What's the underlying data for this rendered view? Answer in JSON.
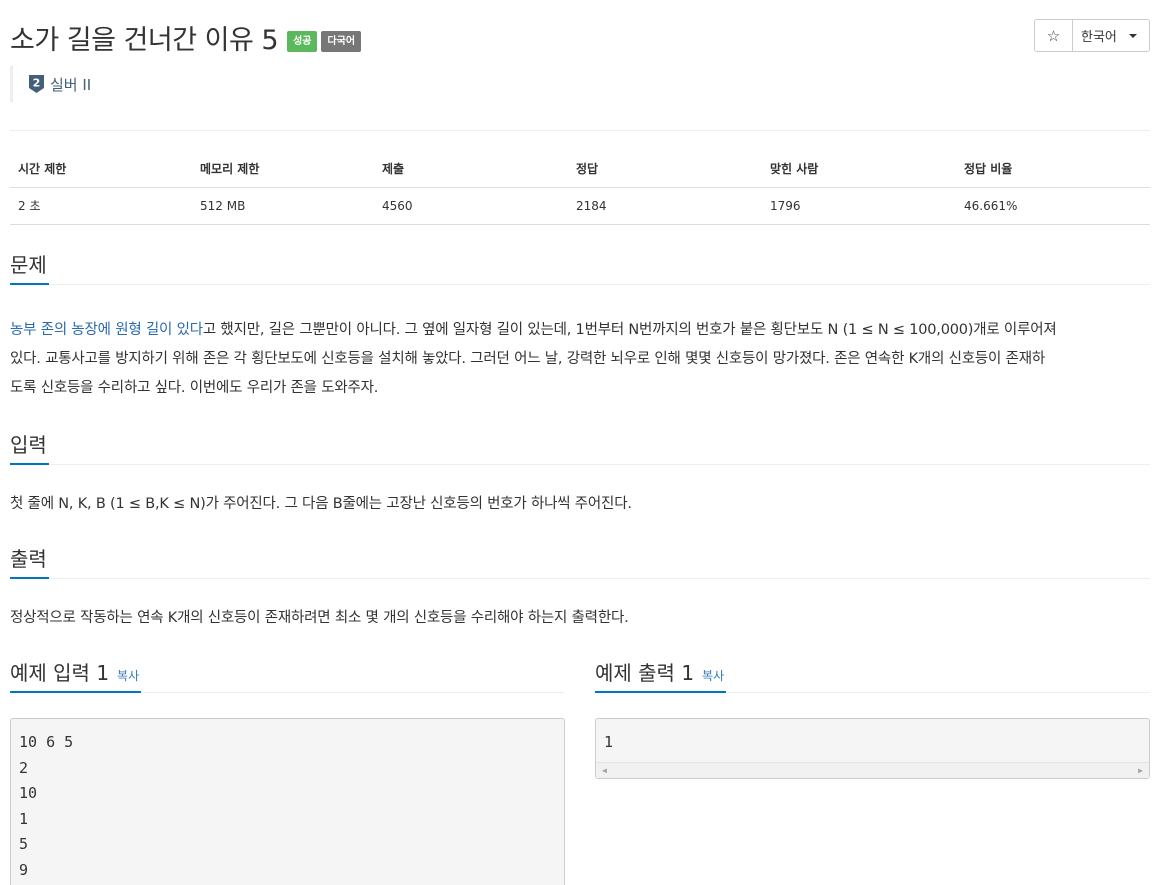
{
  "problem": {
    "title": "소가 길을 건너간 이유 5",
    "badges": [
      "성공",
      "다국어"
    ],
    "tier": "실버 II",
    "tier_number": "2"
  },
  "toolbar": {
    "star": "☆",
    "language": "한국어"
  },
  "info": {
    "headers": [
      "시간 제한",
      "메모리 제한",
      "제출",
      "정답",
      "맞힌 사람",
      "정답 비율"
    ],
    "values": [
      "2 초",
      "512 MB",
      "4560",
      "2184",
      "1796",
      "46.661%"
    ]
  },
  "sections": {
    "description_title": "문제",
    "description_link": "농부 존의 농장에 원형 길이 있다",
    "description_lines": [
      "고 했지만, 길은 그뿐만이 아니다. 그 옆에 일자형 길이 있는데, 1번부터 N번까지의 번호가 붙은 횡단보도 N (1 ≤ N ≤ 100,000)개로 이루어져",
      "있다. 교통사고를 방지하기 위해 존은 각 횡단보도에 신호등을 설치해 놓았다. 그러던 어느 날, 강력한 뇌우로 인해 몇몇 신호등이 망가졌다. 존은 연속한 K개의 신호등이 존재하",
      "도록 신호등을 수리하고 싶다. 이번에도 우리가 존을 도와주자."
    ],
    "input_title": "입력",
    "input_text": "첫 줄에 N, K, B (1 ≤ B,K ≤ N)가 주어진다. 그 다음 B줄에는 고장난 신호등의 번호가 하나씩 주어진다.",
    "output_title": "출력",
    "output_text": "정상적으로 작동하는 연속 K개의 신호등이 존재하려면 최소 몇 개의 신호등을 수리해야 하는지 출력한다."
  },
  "samples": {
    "input_title": "예제 입력 1",
    "output_title": "예제 출력 1",
    "copy_label": "복사",
    "input_lines": [
      "10 6 5",
      "2",
      "10",
      "1",
      "5",
      "9"
    ],
    "output_lines": [
      "1"
    ]
  },
  "colors": {
    "success": "#5cb85c",
    "multilang": "#777777",
    "link": "#2a6ab0",
    "heading_underline": "#0076c0",
    "tier": "#435f7a"
  }
}
